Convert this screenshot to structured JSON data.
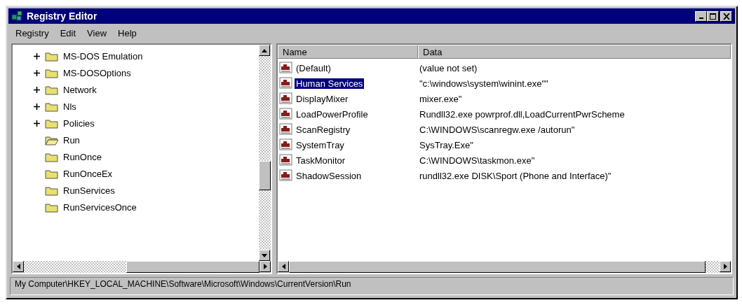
{
  "window": {
    "title": "Registry Editor"
  },
  "menu": [
    "Registry",
    "Edit",
    "View",
    "Help"
  ],
  "tree": {
    "items": [
      {
        "label": "MS-DOS Emulation",
        "expandable": true,
        "open": false
      },
      {
        "label": "MS-DOSOptions",
        "expandable": true,
        "open": false
      },
      {
        "label": "Network",
        "expandable": true,
        "open": false
      },
      {
        "label": "Nls",
        "expandable": true,
        "open": false
      },
      {
        "label": "Policies",
        "expandable": true,
        "open": false
      },
      {
        "label": "Run",
        "expandable": false,
        "open": true
      },
      {
        "label": "RunOnce",
        "expandable": false,
        "open": false
      },
      {
        "label": "RunOnceEx",
        "expandable": false,
        "open": false
      },
      {
        "label": "RunServices",
        "expandable": false,
        "open": false
      },
      {
        "label": "RunServicesOnce",
        "expandable": false,
        "open": false
      }
    ]
  },
  "values": {
    "columns": [
      "Name",
      "Data"
    ],
    "rows": [
      {
        "name": "(Default)",
        "data": "(value not set)",
        "selected": false
      },
      {
        "name": "Human Services",
        "data": "\"c:\\windows\\system\\winint.exe\"\"",
        "selected": true
      },
      {
        "name": "DisplayMixer",
        "data": "mixer.exe\"",
        "selected": false
      },
      {
        "name": "LoadPowerProfile",
        "data": "Rundll32.exe powrprof.dll,LoadCurrentPwrScheme",
        "selected": false
      },
      {
        "name": "ScanRegistry",
        "data": "C:\\WINDOWS\\scanregw.exe /autorun\"",
        "selected": false
      },
      {
        "name": "SystemTray",
        "data": "SysTray.Exe\"",
        "selected": false
      },
      {
        "name": "TaskMonitor",
        "data": "C:\\WINDOWS\\taskmon.exe\"",
        "selected": false
      },
      {
        "name": "ShadowSession",
        "data": "rundll32.exe DISK\\Sport (Phone and Interface)\"",
        "selected": false
      }
    ]
  },
  "status_bar": "My Computer\\HKEY_LOCAL_MACHINE\\Software\\Microsoft\\Windows\\CurrentVersion\\Run"
}
